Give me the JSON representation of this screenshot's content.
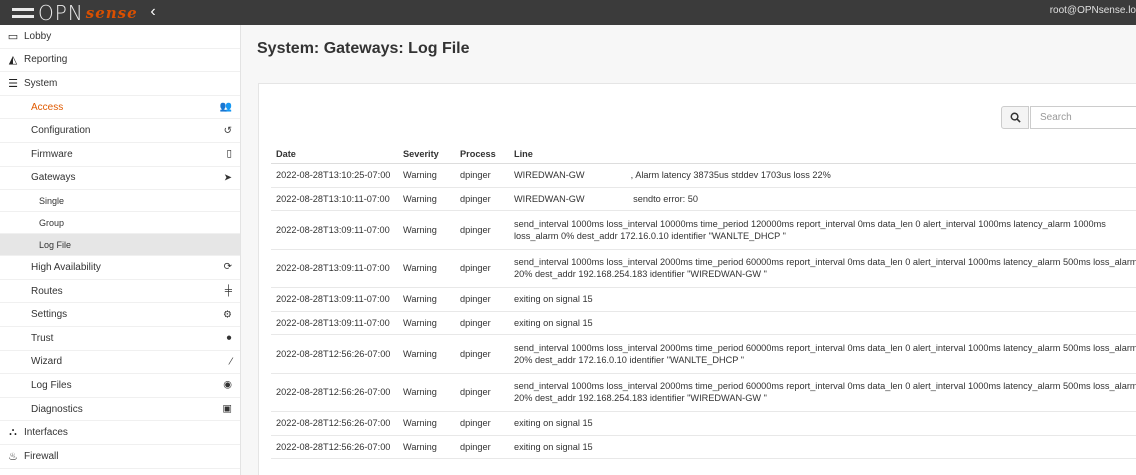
{
  "brand": {
    "name": "OPN",
    "suffix": "sense"
  },
  "topbar": {
    "collapse_icon": "chevron-left-icon",
    "user": "root@OPNsense.lo"
  },
  "sidebar": {
    "top": [
      {
        "label": "Lobby",
        "icon": "laptop-icon"
      },
      {
        "label": "Reporting",
        "icon": "area-chart-icon"
      },
      {
        "label": "System",
        "icon": "server-icon"
      }
    ],
    "system_items": [
      {
        "label": "Access",
        "icon": "users-icon",
        "active": true
      },
      {
        "label": "Configuration",
        "icon": "history-icon"
      },
      {
        "label": "Firmware",
        "icon": "building-icon"
      },
      {
        "label": "Gateways",
        "icon": "location-arrow-icon"
      }
    ],
    "gateways_items": [
      {
        "label": "Single"
      },
      {
        "label": "Group"
      },
      {
        "label": "Log File",
        "selected": true
      }
    ],
    "system_items2": [
      {
        "label": "High Availability",
        "icon": "refresh-icon"
      },
      {
        "label": "Routes",
        "icon": "map-signs-icon"
      },
      {
        "label": "Settings",
        "icon": "cogs-icon"
      },
      {
        "label": "Trust",
        "icon": "certificate-icon"
      },
      {
        "label": "Wizard",
        "icon": "magic-icon"
      },
      {
        "label": "Log Files",
        "icon": "eye-icon"
      },
      {
        "label": "Diagnostics",
        "icon": "medkit-icon"
      }
    ],
    "bottom": [
      {
        "label": "Interfaces",
        "icon": "sitemap-icon"
      },
      {
        "label": "Firewall",
        "icon": "fire-icon"
      }
    ]
  },
  "page": {
    "title": "System: Gateways: Log File"
  },
  "search": {
    "placeholder": "Search"
  },
  "table": {
    "headers": [
      "Date",
      "Severity",
      "Process",
      "Line"
    ],
    "rows": [
      {
        "date": "2022-08-28T13:10:25-07:00",
        "severity": "Warning",
        "process": "dpinger",
        "line_a": "WIREDWAN-GW",
        "line_b": ", Alarm latency 38735us stddev 1703us loss 22%",
        "redacted": true
      },
      {
        "date": "2022-08-28T13:10:11-07:00",
        "severity": "Warning",
        "process": "dpinger",
        "line_a": "WIREDWAN-GW",
        "line_b": " sendto error: 50",
        "redacted": true
      },
      {
        "date": "2022-08-28T13:09:11-07:00",
        "severity": "Warning",
        "process": "dpinger",
        "line": "send_interval 1000ms loss_interval 10000ms time_period 120000ms report_interval 0ms data_len 0 alert_interval 1000ms latency_alarm 1000ms loss_alarm 0% dest_addr 172.16.0.10 identifier \"WANLTE_DHCP \"",
        "double": true
      },
      {
        "date": "2022-08-28T13:09:11-07:00",
        "severity": "Warning",
        "process": "dpinger",
        "line": "send_interval 1000ms loss_interval 2000ms time_period 60000ms report_interval 0ms data_len 0 alert_interval 1000ms latency_alarm 500ms loss_alarm 20% dest_addr 192.168.254.183 identifier \"WIREDWAN-GW \"",
        "double": true
      },
      {
        "date": "2022-08-28T13:09:11-07:00",
        "severity": "Warning",
        "process": "dpinger",
        "line": "exiting on signal 15"
      },
      {
        "date": "2022-08-28T13:09:11-07:00",
        "severity": "Warning",
        "process": "dpinger",
        "line": "exiting on signal 15"
      },
      {
        "date": "2022-08-28T12:56:26-07:00",
        "severity": "Warning",
        "process": "dpinger",
        "line": "send_interval 1000ms loss_interval 2000ms time_period 60000ms report_interval 0ms data_len 0 alert_interval 1000ms latency_alarm 500ms loss_alarm 20% dest_addr 172.16.0.10 identifier \"WANLTE_DHCP \"",
        "double": true
      },
      {
        "date": "2022-08-28T12:56:26-07:00",
        "severity": "Warning",
        "process": "dpinger",
        "line": "send_interval 1000ms loss_interval 2000ms time_period 60000ms report_interval 0ms data_len 0 alert_interval 1000ms latency_alarm 500ms loss_alarm 20% dest_addr 192.168.254.183 identifier \"WIREDWAN-GW \"",
        "double": true
      },
      {
        "date": "2022-08-28T12:56:26-07:00",
        "severity": "Warning",
        "process": "dpinger",
        "line": "exiting on signal 15"
      },
      {
        "date": "2022-08-28T12:56:26-07:00",
        "severity": "Warning",
        "process": "dpinger",
        "line": "exiting on signal 15"
      }
    ]
  },
  "colors": {
    "accent": "#e05a00",
    "topbar": "#3b3b3b"
  }
}
